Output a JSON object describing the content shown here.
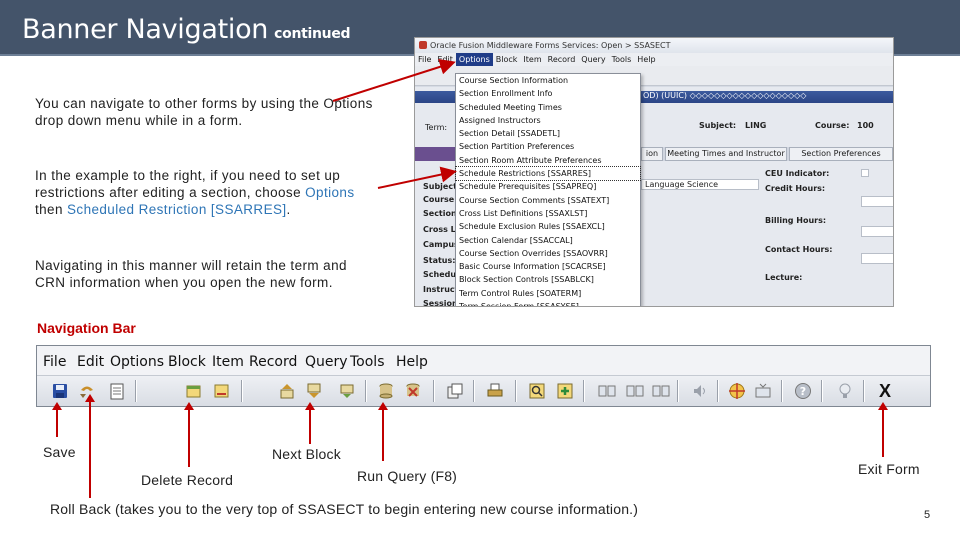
{
  "title": {
    "main": "Banner Navigation",
    "sub": "continued"
  },
  "paragraphs": {
    "p1": "You can navigate to other forms by using the Options drop down menu while in a form.",
    "p2_before": "In the example to the right, if you need to set up restrictions after editing a section, choose ",
    "p2_options": "Options",
    "p2_then": " then ",
    "p2_restriction": "Scheduled Restriction [SSARRES]",
    "p2_end": ".",
    "p3": "Navigating in this manner will retain the term and CRN information when you open the new form."
  },
  "screenshot": {
    "window_title": "Oracle Fusion Middleware Forms Services: Open > SSASECT",
    "menu": [
      "File",
      "Edit",
      "Options",
      "Block",
      "Item",
      "Record",
      "Query",
      "Tools",
      "Help"
    ],
    "menu_selected": "Options",
    "strip_text": "OD) (UUIC) ◇◇◇◇◇◇◇◇◇◇◇◇◇◇◇◇◇◇◇",
    "term_label": "Term:",
    "subject_label": "Subject:",
    "subject_value": "LING",
    "course_label": "Course:",
    "course_value": "100",
    "tabs": [
      "ion",
      "Meeting Times and Instructor",
      "Section Preferences"
    ],
    "ceu_label": "CEU Indicator:",
    "credit_label": "Credit Hours:",
    "billing_label": "Billing Hours:",
    "contact_label": "Contact Hours:",
    "lecture_label": "Lecture:",
    "field_value": "Language Science",
    "left_labels": [
      "Subject",
      "Course",
      "Section",
      "Cross L",
      "Campus",
      "Status:",
      "Schedu",
      "Instruct",
      "Session"
    ],
    "options_items": [
      "Course Section Information",
      "Section Enrollment Info",
      "Scheduled Meeting Times",
      "Assigned Instructors",
      "Section Detail [SSADETL]",
      "Section Partition Preferences",
      "Section Room Attribute Preferences",
      "Schedule Restrictions [SSARRES]",
      "Schedule Prerequisites [SSAPREQ]",
      "Course Section Comments [SSATEXT]",
      "Cross List Definitions [SSAXLST]",
      "Schedule Exclusion Rules [SSAEXCL]",
      "Section Calendar [SSACCAL]",
      "Course Section Overrides [SSAOVRR]",
      "Basic Course Information [SCACRSE]",
      "Block Section Controls [SSABLCK]",
      "Term Control Rules [SOATERM]",
      "Term Session Form [SSASYSE]"
    ],
    "options_selected_index": 7
  },
  "nav_caption": "Navigation Bar",
  "navbar": {
    "menu": [
      "File",
      "Edit",
      "Options",
      "Block",
      "Item",
      "Record",
      "Query",
      "Tools",
      "Help"
    ],
    "exit_glyph": "X"
  },
  "labels": {
    "save": "Save",
    "delete_record": "Delete Record",
    "next_block": "Next Block",
    "run_query": "Run Query (F8)",
    "exit_form": "Exit Form",
    "roll_back": "Roll Back (takes you to the very top of SSASECT to begin entering new course information.)"
  },
  "page_number": "5",
  "colors": {
    "title_bg": "#44546a",
    "accent_text": "#2e75b6",
    "arrow": "#c00000",
    "caption": "#c00000"
  }
}
